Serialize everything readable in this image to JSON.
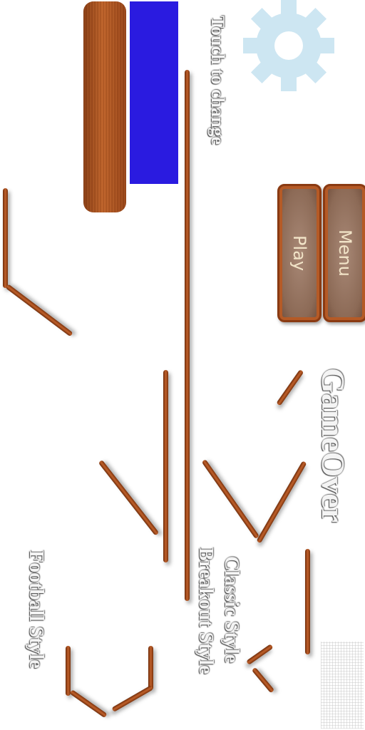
{
  "settings": {
    "icon": "gear-icon",
    "color": "#cde6f2"
  },
  "style_picker": {
    "hint": "Touch to change",
    "selected_color": "#2a1be0",
    "wood_swatch": "wood-texture"
  },
  "buttons": {
    "play": "Play",
    "menu": "Menu"
  },
  "title": "GameOver",
  "styles": {
    "classic": "Classic Style",
    "breakout": "Breakout Style",
    "football": "Football Style"
  }
}
